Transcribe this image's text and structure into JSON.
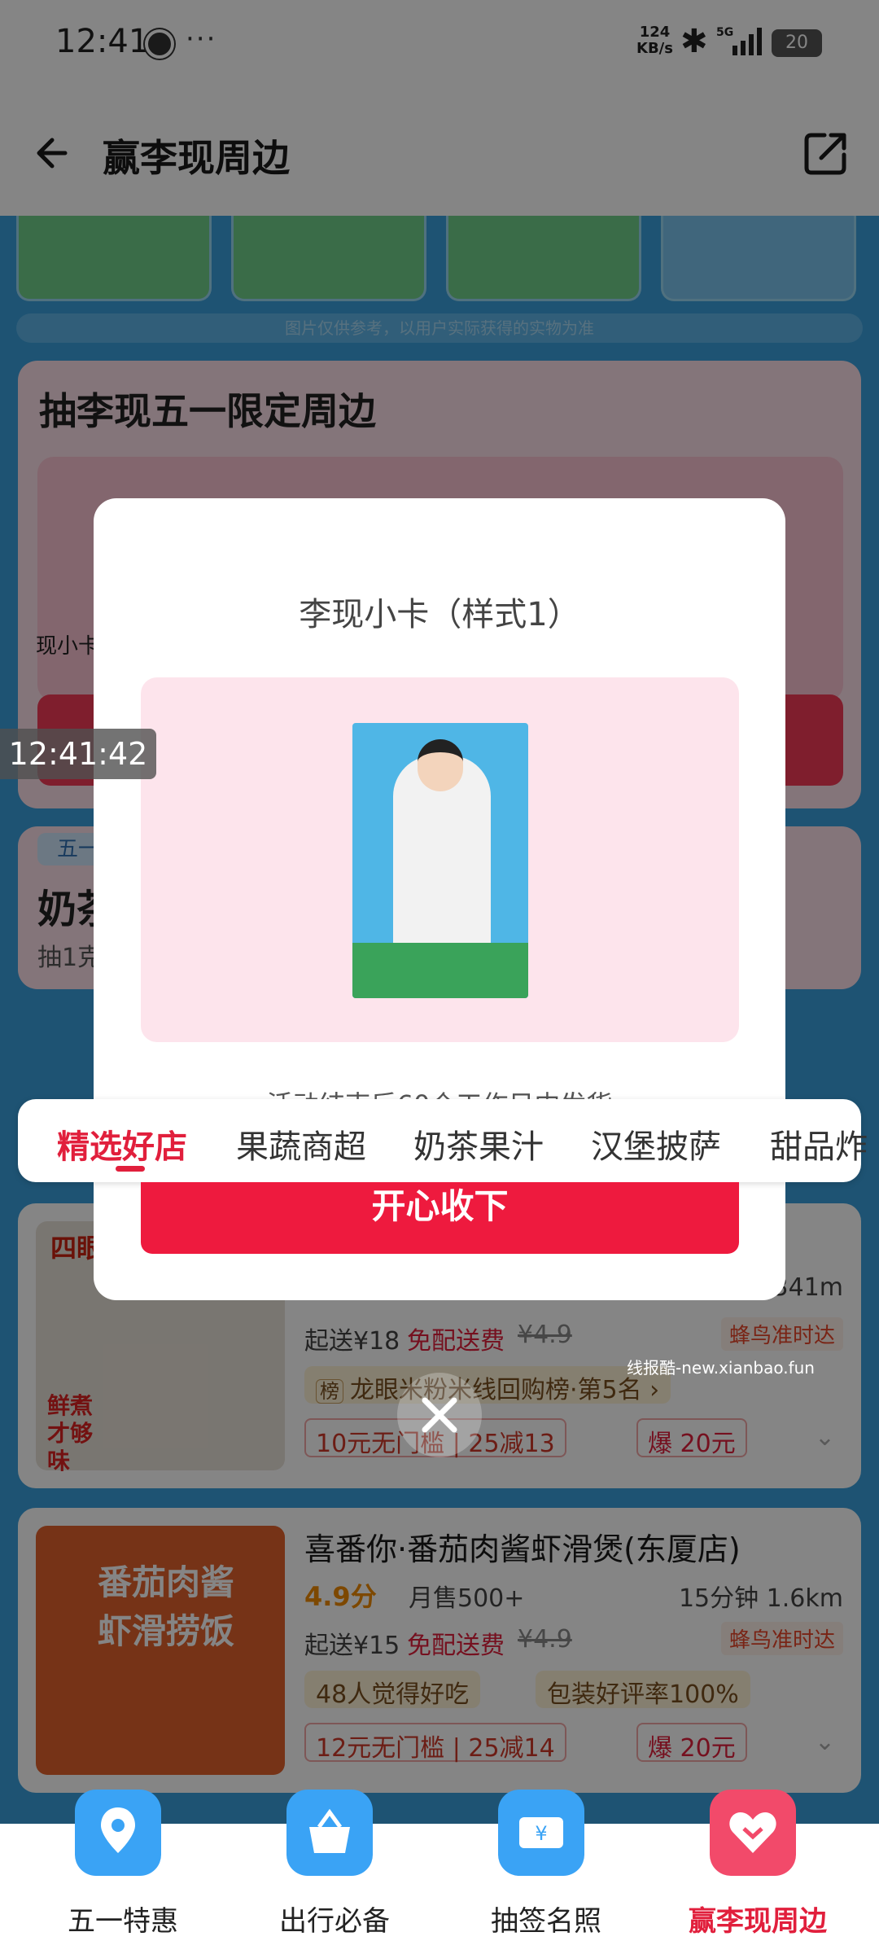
{
  "status_bar": {
    "time": "12:41",
    "more": "···",
    "net_speed_value": "124",
    "net_speed_unit": "KB/s",
    "network_type": "5G",
    "battery": "20"
  },
  "header": {
    "title": "赢李现周边"
  },
  "disclaimer": "图片仅供参考，以用户实际获得的实物为准",
  "limit_section": {
    "title": "抽李现五一限定周边",
    "cut_label": "现小卡"
  },
  "milk_section": {
    "badge": "五一",
    "title": "奶茶",
    "sub": "抽1克"
  },
  "tabs": [
    "精选好店",
    "果蔬商超",
    "奶茶果汁",
    "汉堡披萨",
    "甜品炸"
  ],
  "shops": [
    {
      "name": "四眼",
      "score": "",
      "sales": "",
      "dist": "341m",
      "start": "起送¥18",
      "free": "免配送费",
      "orig": "¥4.9",
      "fengniao": "蜂鸟准时达",
      "rank": "龙眼米粉米线回购榜·第5名",
      "rank_badge": "榜",
      "deal": "10元无门槛 | 25减13",
      "bao": "爆 20元",
      "thumb_text": "鲜煮 才够味"
    },
    {
      "name": "喜番你·番茄肉酱虾滑煲(东厦店)",
      "score": "4.9分",
      "sales": "月售500+",
      "dist": "15分钟 1.6km",
      "start": "起送¥15",
      "free": "免配送费",
      "orig": "¥4.9",
      "fengniao": "蜂鸟准时达",
      "tag1": "48人觉得好吃",
      "tag2": "包装好评率100%",
      "deal": "12元无门槛 | 25减14",
      "bao": "爆 20元",
      "thumb_text": "番茄肉酱 虾滑捞饭"
    }
  ],
  "modal": {
    "title": "李现小卡（样式1）",
    "note": "活动结束后60个工作日内发货",
    "confirm": "开心收下"
  },
  "timestamp_overlay": "12:41:42",
  "watermark": "线报酷-new.xianbao.fun",
  "bottom_nav": [
    {
      "label": "五一特惠",
      "icon": "map-pin-icon",
      "color": "#3aa3f5"
    },
    {
      "label": "出行必备",
      "icon": "basket-icon",
      "color": "#3aa3f5"
    },
    {
      "label": "抽签名照",
      "icon": "ticket-icon",
      "color": "#3aa3f5"
    },
    {
      "label": "赢李现周边",
      "icon": "heart-icon",
      "color": "#f24a6a"
    }
  ],
  "colors": {
    "accent": "#e11f3c",
    "bg": "#3a9fdc",
    "score": "#f08a00"
  }
}
